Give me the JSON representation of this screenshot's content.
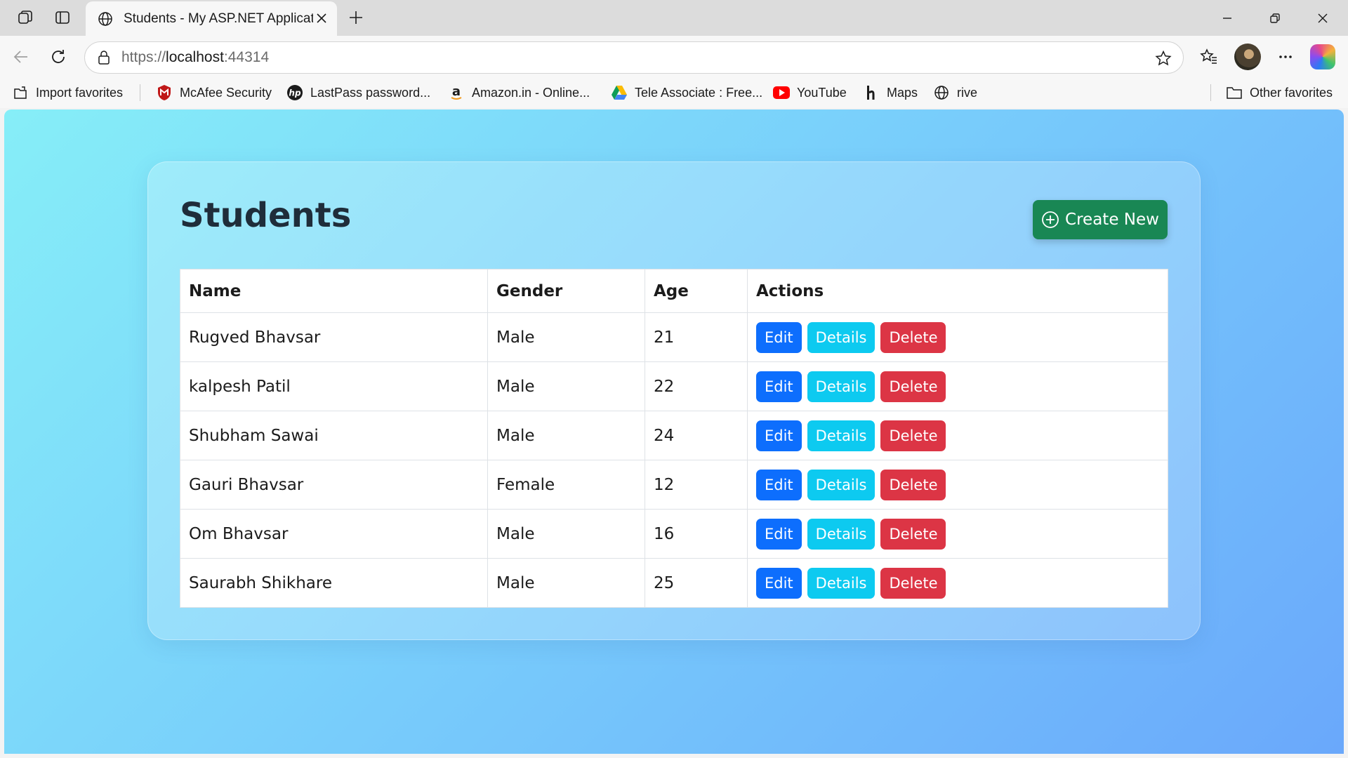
{
  "browser": {
    "tab_title": "Students - My ASP.NET Applicatio",
    "url_scheme": "https://",
    "url_host": "localhost",
    "url_port": ":44314",
    "icons": {
      "workspaces": "workspaces-icon",
      "tab_actions": "tab-actions-icon",
      "back": "back-arrow-icon",
      "refresh": "refresh-icon",
      "lock": "lock-icon",
      "favorite_star": "star-icon",
      "favorites": "favorites-icon",
      "more": "more-icon"
    }
  },
  "favorites": [
    {
      "label": "Import favorites",
      "icon": "import-icon"
    },
    {
      "label": "McAfee Security",
      "icon": "mcafee-icon"
    },
    {
      "label": "LastPass password...",
      "icon": "hp-icon"
    },
    {
      "label": "Amazon.in - Online...",
      "icon": "amazon-icon"
    },
    {
      "label": "Tele Associate : Free...",
      "icon": "google-drive-icon"
    },
    {
      "label": "YouTube",
      "icon": "youtube-icon"
    },
    {
      "label": "Maps",
      "icon": "maps-icon"
    },
    {
      "label": "rive",
      "icon": "globe-icon"
    }
  ],
  "other_favorites": "Other favorites",
  "page": {
    "title": "Students",
    "create_label": "Create New",
    "columns": [
      "Name",
      "Gender",
      "Age",
      "Actions"
    ],
    "rows": [
      {
        "name": "Rugved Bhavsar",
        "gender": "Male",
        "age": "21"
      },
      {
        "name": "kalpesh Patil",
        "gender": "Male",
        "age": "22"
      },
      {
        "name": "Shubham Sawai",
        "gender": "Male",
        "age": "24"
      },
      {
        "name": "Gauri Bhavsar",
        "gender": "Female",
        "age": "12"
      },
      {
        "name": "Om Bhavsar",
        "gender": "Male",
        "age": "16"
      },
      {
        "name": "Saurabh Shikhare",
        "gender": "Male",
        "age": "25"
      }
    ],
    "actions": {
      "edit": "Edit",
      "details": "Details",
      "delete": "Delete"
    }
  },
  "colors": {
    "create": "#198754",
    "edit": "#0d6efd",
    "details": "#0dcaf0",
    "delete": "#dc3545"
  }
}
